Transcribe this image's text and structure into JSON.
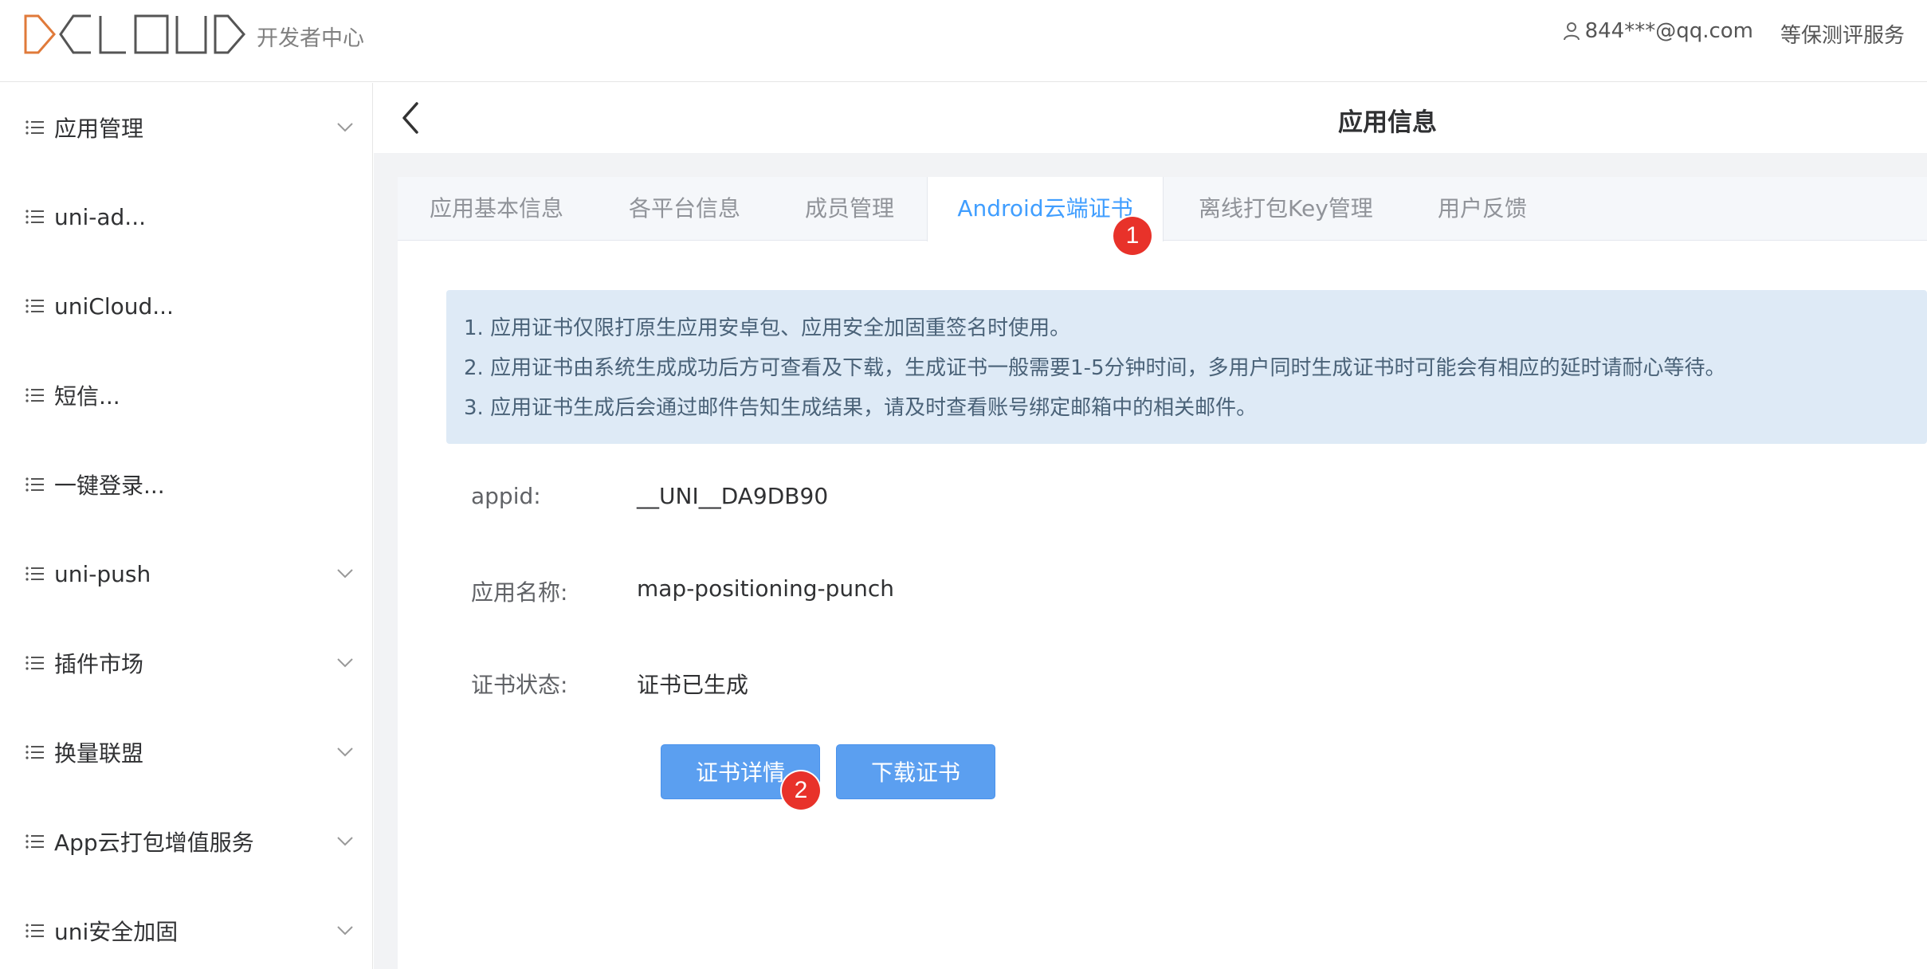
{
  "header": {
    "logo_text": "DCLOUD",
    "logo_subtitle": "开发者中心",
    "user_email": "844***@qq.com",
    "service_link": "等保测评服务"
  },
  "sidebar": {
    "items": [
      {
        "label": "应用管理",
        "expandable": true
      },
      {
        "label": "uni-ad...",
        "expandable": false
      },
      {
        "label": "uniCloud...",
        "expandable": false
      },
      {
        "label": "短信...",
        "expandable": false
      },
      {
        "label": "一键登录...",
        "expandable": false
      },
      {
        "label": "uni-push",
        "expandable": true
      },
      {
        "label": "插件市场",
        "expandable": true
      },
      {
        "label": "换量联盟",
        "expandable": true
      },
      {
        "label": "App云打包增值服务",
        "expandable": true
      },
      {
        "label": "uni安全加固",
        "expandable": true
      }
    ]
  },
  "main": {
    "title": "应用信息",
    "tabs": [
      {
        "label": "应用基本信息"
      },
      {
        "label": "各平台信息"
      },
      {
        "label": "成员管理"
      },
      {
        "label": "Android云端证书",
        "active": true
      },
      {
        "label": "离线打包Key管理"
      },
      {
        "label": "用户反馈"
      }
    ],
    "notice": [
      "1. 应用证书仅限打原生应用安卓包、应用安全加固重签名时使用。",
      "2. 应用证书由系统生成成功后方可查看及下载，生成证书一般需要1-5分钟时间，多用户同时生成证书时可能会有相应的延时请耐心等待。",
      "3. 应用证书生成后会通过邮件告知生成结果，请及时查看账号绑定邮箱中的相关邮件。"
    ],
    "fields": {
      "appid_label": "appid:",
      "appid_value": "__UNI__DA9DB90",
      "name_label": "应用名称:",
      "name_value": "map-positioning-punch",
      "status_label": "证书状态:",
      "status_value": "证书已生成"
    },
    "buttons": {
      "details": "证书详情",
      "download": "下载证书"
    },
    "annotations": {
      "step1": "1",
      "step2": "2"
    }
  },
  "colors": {
    "accent": "#409eff",
    "button": "#5b9ff0",
    "badge": "#e8322a",
    "notice_bg": "#deeaf6",
    "logo_orange": "#e07a3a"
  }
}
